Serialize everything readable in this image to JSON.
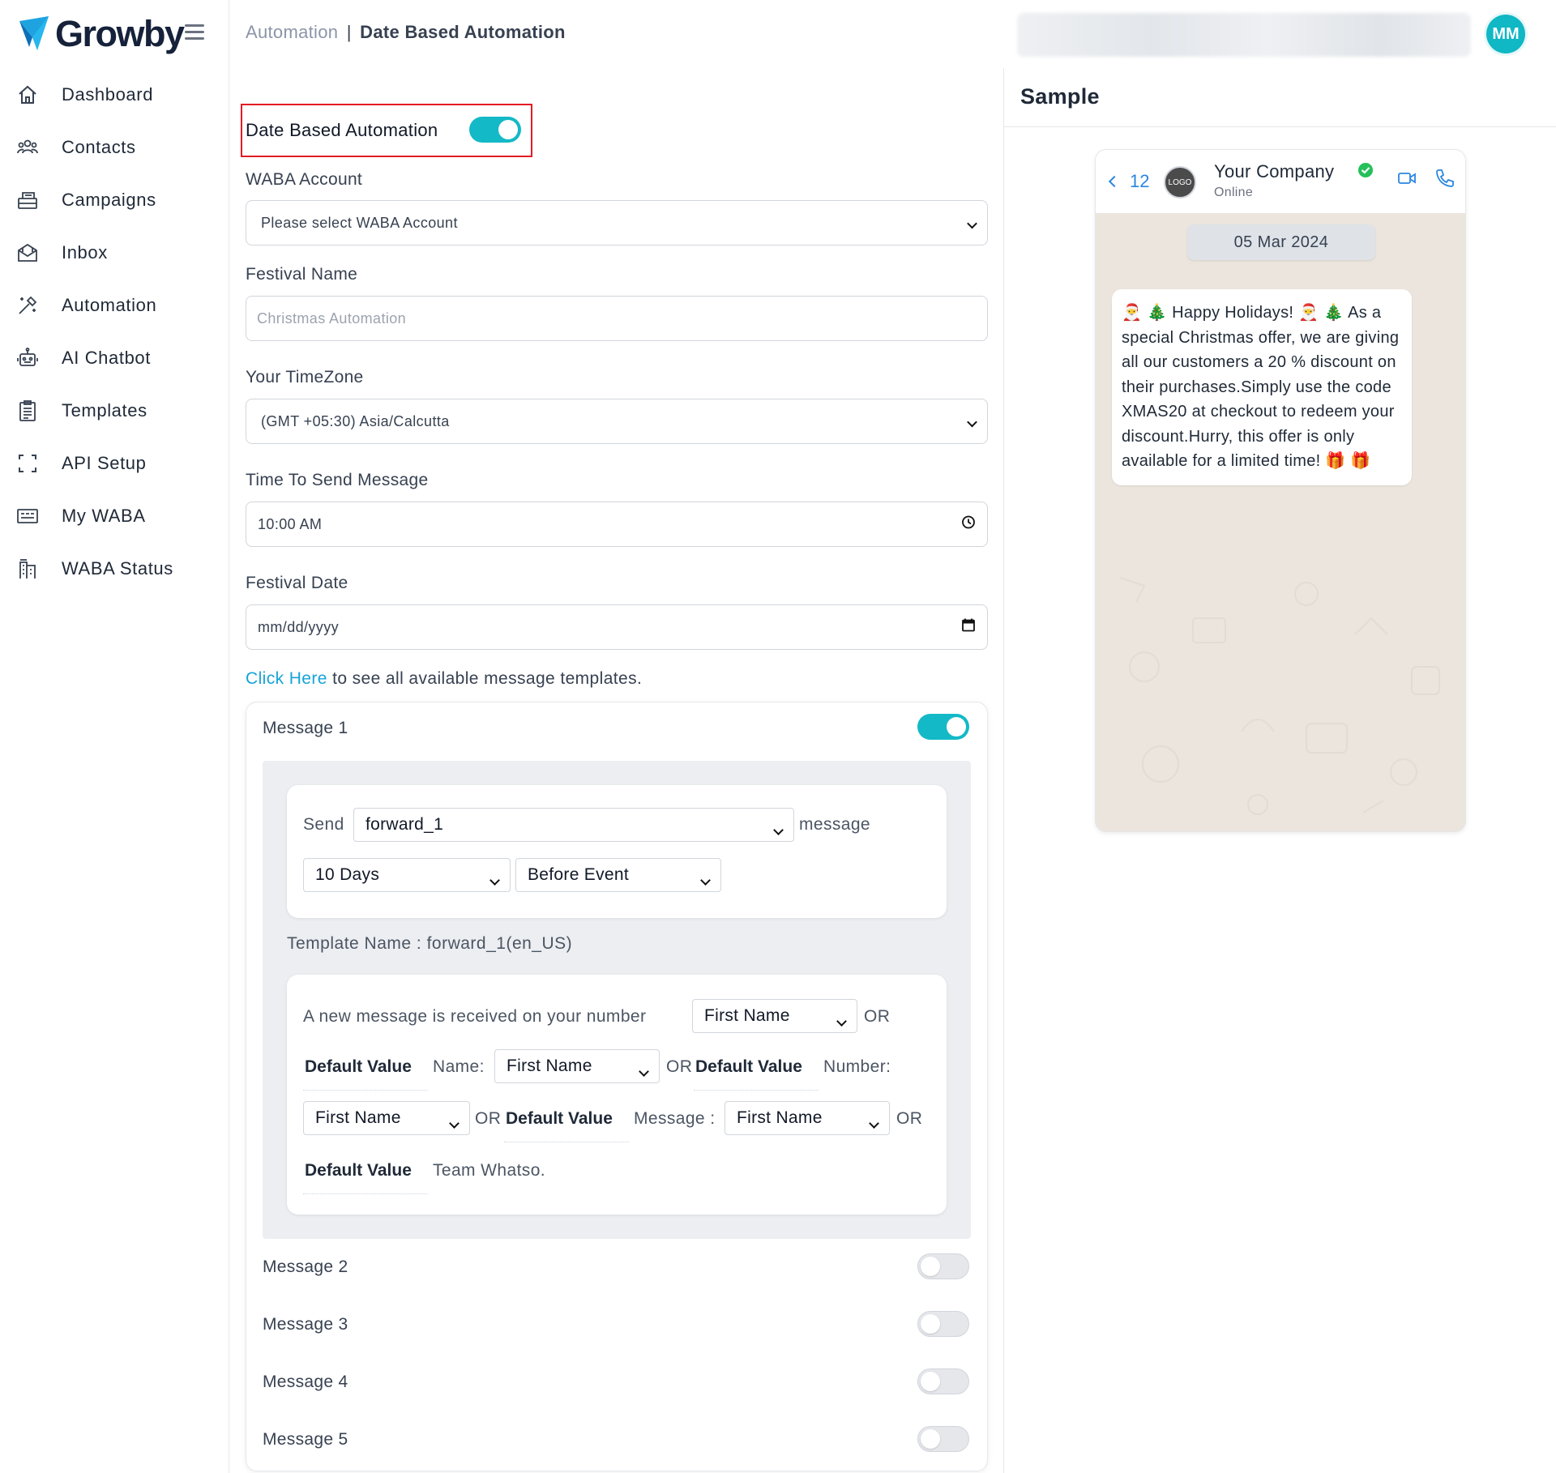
{
  "app": {
    "brand": "Growby",
    "accent_color": "#13b9c6",
    "user_initials": "MM"
  },
  "sidebar": {
    "items": [
      {
        "label": "Dashboard",
        "icon": "home-icon"
      },
      {
        "label": "Contacts",
        "icon": "contacts-icon"
      },
      {
        "label": "Campaigns",
        "icon": "campaigns-icon"
      },
      {
        "label": "Inbox",
        "icon": "inbox-icon"
      },
      {
        "label": "Automation",
        "icon": "automation-icon"
      },
      {
        "label": "AI Chatbot",
        "icon": "robot-icon"
      },
      {
        "label": "Templates",
        "icon": "templates-icon"
      },
      {
        "label": "API Setup",
        "icon": "api-icon"
      },
      {
        "label": "My WABA",
        "icon": "waba-icon"
      },
      {
        "label": "WABA Status",
        "icon": "status-icon"
      }
    ]
  },
  "breadcrumb": {
    "parent": "Automation",
    "separator": "|",
    "current": "Date Based Automation"
  },
  "form": {
    "date_based_label": "Date Based Automation",
    "date_based_enabled": true,
    "waba_label": "WABA Account",
    "waba_value": "Please select WABA Account",
    "festival_name_label": "Festival Name",
    "festival_name_placeholder": "Christmas Automation",
    "timezone_label": "Your TimeZone",
    "timezone_value": "(GMT +05:30) Asia/Calcutta",
    "time_label": "Time To Send Message",
    "time_value": "10:00 AM",
    "festival_date_label": "Festival Date",
    "festival_date_value": "mm/dd/yyyy",
    "click_here": "Click Here",
    "click_rest": " to see all available message templates."
  },
  "messages": {
    "items": [
      {
        "title": "Message 1",
        "enabled": true
      },
      {
        "title": "Message 2",
        "enabled": false
      },
      {
        "title": "Message 3",
        "enabled": false
      },
      {
        "title": "Message 4",
        "enabled": false
      },
      {
        "title": "Message 5",
        "enabled": false
      }
    ],
    "m1": {
      "send_label": "Send",
      "template_select": "forward_1",
      "message_label": "message",
      "days_select": "10 Days",
      "timing_select": "Before Event",
      "template_name": "Template Name : forward_1(en_US)",
      "body_text": "A new message is received on your number",
      "var1_select": "First Name",
      "or_text": "OR",
      "default_value": "Default Value",
      "name_text": "Name:",
      "var2_select": "First Name",
      "number_text": "Number:",
      "var3_select": "First Name",
      "message_text": "Message :",
      "var4_select": "First Name",
      "team_text": "Team Whatso."
    }
  },
  "sample": {
    "title": "Sample",
    "back_count": "12",
    "logo_text": "LOGO",
    "company": "Your Company",
    "status": "Online",
    "date": "05 Mar 2024",
    "message": "🎅 🎄 Happy Holidays! 🎅 🎄 As a special Christmas offer, we are giving all our customers a 20 % discount on their purchases.Simply use the code XMAS20 at checkout to redeem your discount.Hurry, this offer is only available for a limited time! 🎁 🎁"
  }
}
